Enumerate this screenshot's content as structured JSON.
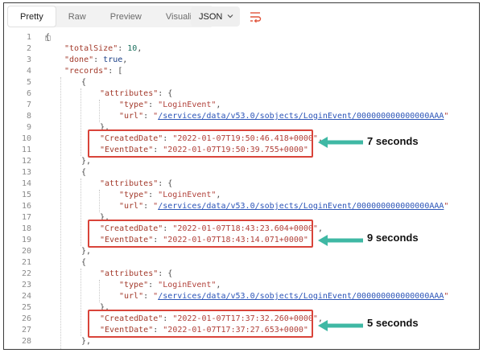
{
  "toolbar": {
    "tabs": [
      {
        "label": "Pretty",
        "active": true
      },
      {
        "label": "Raw",
        "active": false
      },
      {
        "label": "Preview",
        "active": false
      },
      {
        "label": "Visualize",
        "active": false
      }
    ],
    "format_select": "JSON",
    "wrap_icon": "text-wrap-icon"
  },
  "code": {
    "line_numbers": [
      "1",
      "2",
      "3",
      "4",
      "5",
      "6",
      "7",
      "8",
      "9",
      "10",
      "11",
      "12",
      "13",
      "14",
      "15",
      "16",
      "17",
      "18",
      "19",
      "20",
      "21",
      "22",
      "23",
      "24",
      "25",
      "26",
      "27",
      "28"
    ],
    "total_size_key": "\"totalSize\"",
    "total_size_val": "10",
    "done_key": "\"done\"",
    "done_val": "true",
    "records_key": "\"records\"",
    "attributes_key": "\"attributes\"",
    "type_key": "\"type\"",
    "type_val": "\"LoginEvent\"",
    "url_key": "\"url\"",
    "created_key": "\"CreatedDate\"",
    "event_key": "\"EventDate\"",
    "records": [
      {
        "url": "/services/data/v53.0/sobjects/LoginEvent/000000000000000AAA",
        "created": "\"2022-01-07T19:50:46.418+0000\"",
        "event": "\"2022-01-07T19:50:39.755+0000\""
      },
      {
        "url": "/services/data/v53.0/sobjects/LoginEvent/000000000000000AAA",
        "created": "\"2022-01-07T18:43:23.604+0000\"",
        "event": "\"2022-01-07T18:43:14.071+0000\""
      },
      {
        "url": "/services/data/v53.0/sobjects/LoginEvent/000000000000000AAA",
        "created": "\"2022-01-07T17:37:32.260+0000\"",
        "event": "\"2022-01-07T17:37:27.653+0000\""
      }
    ]
  },
  "annotations": [
    {
      "label": "7 seconds"
    },
    {
      "label": "9 seconds"
    },
    {
      "label": "5 seconds"
    }
  ],
  "colors": {
    "highlight": "#d9443a",
    "arrow": "#3fb8a4",
    "key": "#a33a2b",
    "number": "#1a6f5d",
    "url": "#2c55b8"
  }
}
